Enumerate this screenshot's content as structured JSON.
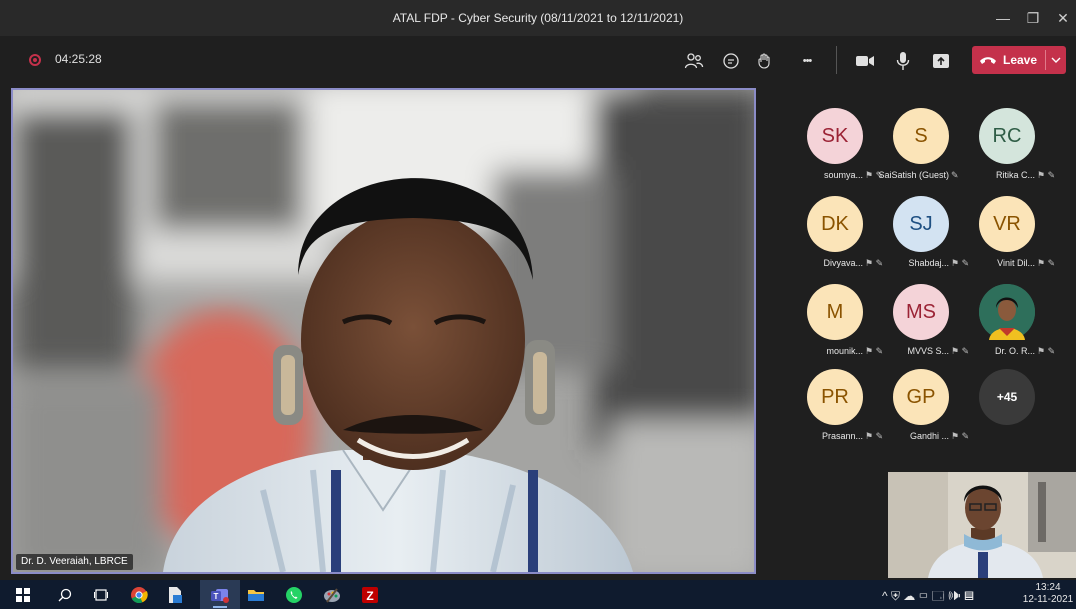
{
  "window": {
    "title": "ATAL FDP - Cyber Security (08/11/2021 to 12/11/2021)",
    "minimize_glyph": "—",
    "maximize_glyph": "❐",
    "close_glyph": "✕"
  },
  "toolbar": {
    "timer": "04:25:28",
    "leave_label": "Leave",
    "more_glyph": "•••"
  },
  "stage": {
    "speaker_name": "Dr. D. Veeraiah, LBRCE"
  },
  "participants": [
    {
      "initials": "SK",
      "name": "soumya...",
      "bg": "#f4d3d8",
      "fg": "#9b2335",
      "status": "⚑ ✎"
    },
    {
      "initials": "S",
      "name": "SaiSatish (Guest)",
      "bg": "#fbe4b8",
      "fg": "#8a5300",
      "status": "✎"
    },
    {
      "initials": "RC",
      "name": "Ritika C...",
      "bg": "#d4e5dc",
      "fg": "#2f5d46",
      "status": "⚑ ✎"
    },
    {
      "initials": "DK",
      "name": "Divyava...",
      "bg": "#fbe4b8",
      "fg": "#8a5300",
      "status": "⚑ ✎"
    },
    {
      "initials": "SJ",
      "name": "Shabdaj...",
      "bg": "#d3e3f2",
      "fg": "#1f5082",
      "status": "⚑ ✎"
    },
    {
      "initials": "VR",
      "name": "Vinit Dil...",
      "bg": "#fbe4b8",
      "fg": "#8a5300",
      "status": "⚑ ✎"
    },
    {
      "initials": "M",
      "name": "mounik...",
      "bg": "#fbe4b8",
      "fg": "#8a5300",
      "status": "⚑ ✎"
    },
    {
      "initials": "MS",
      "name": "MVVS S...",
      "bg": "#f4d3d8",
      "fg": "#9b2335",
      "status": "⚑ ✎"
    },
    {
      "initials": "",
      "name": "Dr. O. R...",
      "bg": "#2e6f5b",
      "fg": "#ffffff",
      "status": "⚑ ✎"
    },
    {
      "initials": "PR",
      "name": "Prasann...",
      "bg": "#fbe4b8",
      "fg": "#8a5300",
      "status": "⚑ ✎"
    },
    {
      "initials": "GP",
      "name": "Gandhi ...",
      "bg": "#fbe4b8",
      "fg": "#8a5300",
      "status": "⚑ ✎"
    }
  ],
  "overflow": {
    "label": "+45"
  },
  "taskbar": {
    "time": "13:24",
    "date": "12-11-2021",
    "tray_glyphs": "^ ⛨ ☁ ▭ 🗔 🕪 ▤"
  },
  "colors": {
    "accent": "#8b8cc7",
    "leave": "#c4314b",
    "titlebar": "#292929",
    "background": "#1f1f1f"
  }
}
